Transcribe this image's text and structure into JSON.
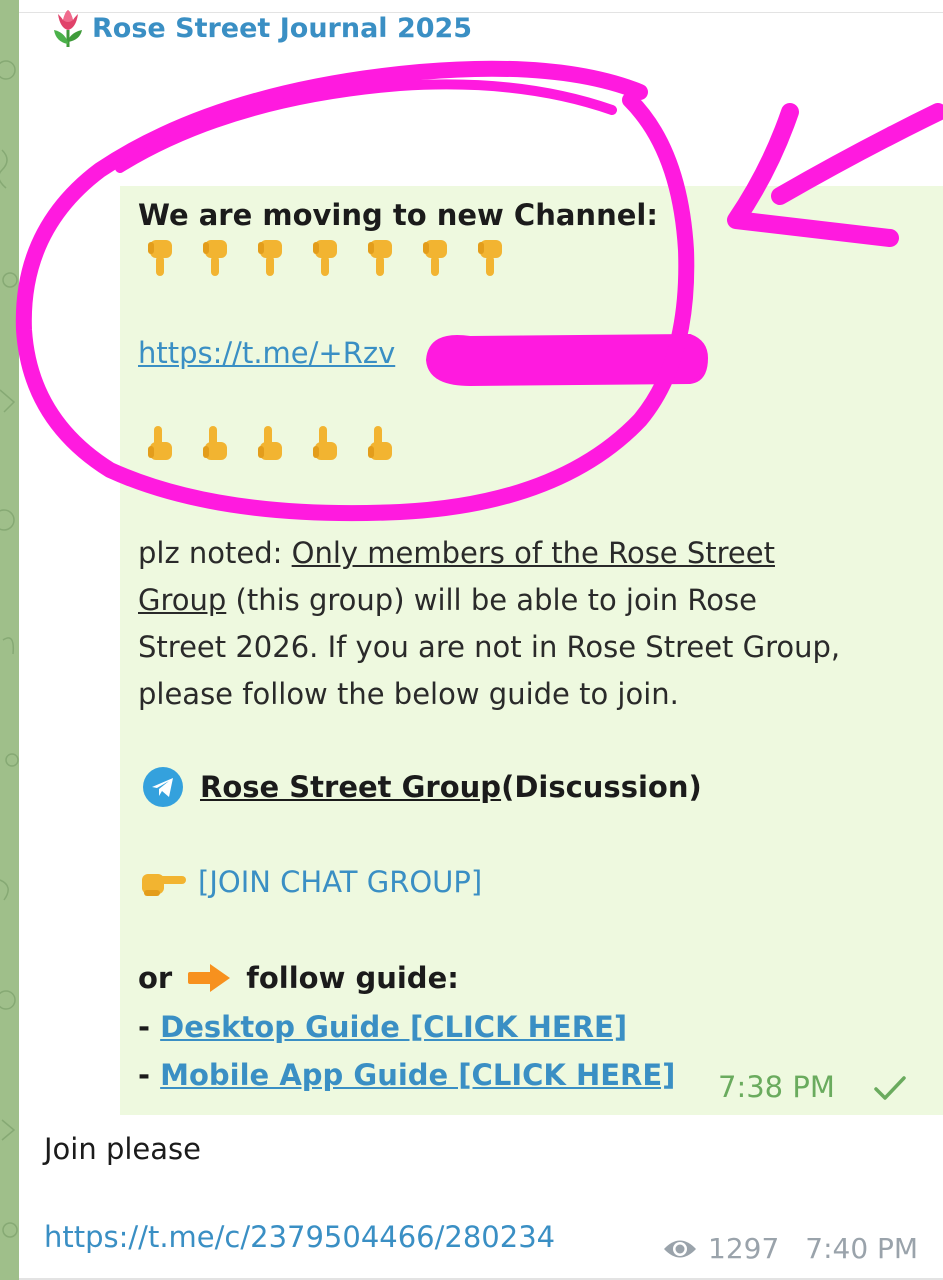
{
  "channel": {
    "name": "Rose Street Journal 2025",
    "avatar_icon": "tulip-icon"
  },
  "forwarded_message": {
    "heading": "We are moving to new Channel:",
    "pointing_down_icon": "backhand-index-pointing-down",
    "pointing_down_count": 7,
    "link": "https://t.me/+Rzv",
    "pointing_up_icon": "backhand-index-pointing-up",
    "pointing_up_count": 5,
    "note_prefix": "plz noted: ",
    "note_underlined_1": "Only members of the Rose Street",
    "note_underlined_2": "Group",
    "note_rest_1": " (this group) will be able to join Rose",
    "note_rest_2": "Street 2026. If you are not in Rose Street Group,",
    "note_rest_3": "please follow the below guide to join.",
    "group_link": "Rose Street Group",
    "group_suffix": " (Discussion)",
    "join_button": "[JOIN CHAT GROUP]",
    "or_label": "or",
    "follow_label": "follow guide:",
    "guide_bullet": "- ",
    "desktop_guide": "Desktop Guide [CLICK HERE]",
    "mobile_guide": "Mobile App Guide [CLICK HERE]",
    "time": "7:38 PM",
    "status_icon": "single-check-icon"
  },
  "message": {
    "text": "Join please",
    "link": "https://t.me/c/2379504466/280234",
    "views": "1297",
    "time": "7:40 PM"
  },
  "colors": {
    "link": "#3a8fc4",
    "forward_bg": "#eef9df",
    "annotation": "#ff1adf",
    "time_green": "#6aab5e"
  }
}
